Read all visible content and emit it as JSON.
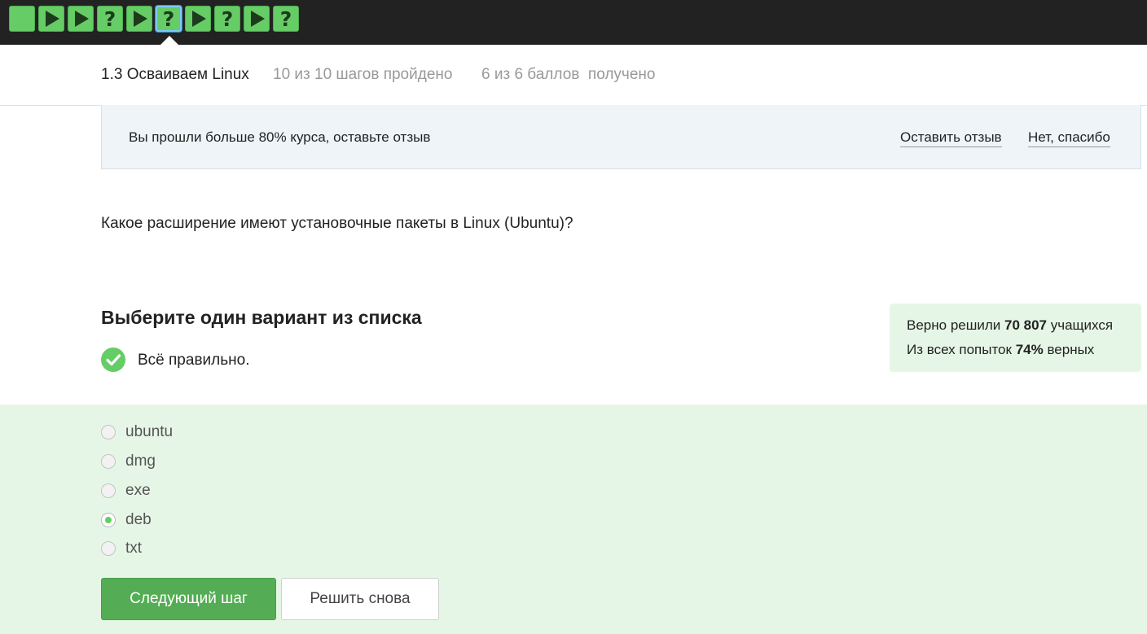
{
  "step_bar": {
    "steps": [
      {
        "type": "text",
        "icon": "text-step-icon"
      },
      {
        "type": "video",
        "icon": "play-icon"
      },
      {
        "type": "video",
        "icon": "play-icon"
      },
      {
        "type": "quiz",
        "icon": "question-icon",
        "glyph": "?"
      },
      {
        "type": "video",
        "icon": "play-icon"
      },
      {
        "type": "quiz",
        "icon": "question-icon",
        "glyph": "?",
        "current": true
      },
      {
        "type": "video",
        "icon": "play-icon"
      },
      {
        "type": "quiz",
        "icon": "question-icon",
        "glyph": "?"
      },
      {
        "type": "video",
        "icon": "play-icon"
      },
      {
        "type": "quiz",
        "icon": "question-icon",
        "glyph": "?"
      }
    ]
  },
  "lesson": {
    "title": "1.3 Осваиваем Linux",
    "steps_progress": "10 из 10 шагов пройдено",
    "score": "6 из 6 баллов  получено"
  },
  "banner": {
    "text": "Вы прошли больше 80% курса, оставьте отзыв",
    "review_link": "Оставить отзыв",
    "decline_link": "Нет, спасибо"
  },
  "question": "Какое расширение имеют установочные пакеты в Linux (Ubuntu)?",
  "task": {
    "title": "Выберите один вариант из списка",
    "result": "Всё правильно.",
    "result_icon": "check-circle-icon"
  },
  "stats": {
    "line1_prefix": "Верно решили ",
    "line1_value": "70 807",
    "line1_suffix": " учащихся",
    "line2_prefix": "Из всех попыток ",
    "line2_value": "74%",
    "line2_suffix": " верных"
  },
  "options": [
    "ubuntu",
    "dmg",
    "exe",
    "deb",
    "txt"
  ],
  "selected_option": "deb",
  "buttons": {
    "next": "Следующий шаг",
    "retry": "Решить снова"
  },
  "colors": {
    "accent_green": "#66cc66",
    "button_green": "#54ad54",
    "answer_bg": "#e6f6e6",
    "banner_bg": "#eef4f8",
    "topbar_bg": "#222222"
  }
}
